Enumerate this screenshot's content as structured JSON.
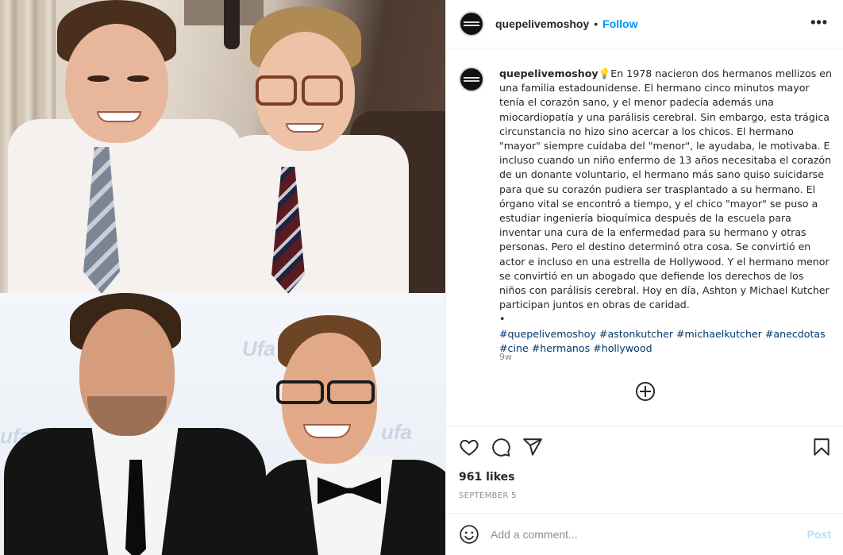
{
  "post": {
    "username": "quepelivemoshoy",
    "follow_label": "Follow",
    "separator": "•",
    "more_options": "•••",
    "caption_intro_emoji": "💡",
    "caption_text": "En 1978 nacieron dos hermanos mellizos en una familia estadounidense. El hermano cinco minutos mayor tenía el corazón sano, y el menor padecía además una miocardiopatía y una parálisis cerebral. Sin embargo, esta trágica circunstancia no hizo sino acercar a los chicos. El hermano \"mayor\" siempre cuidaba del \"menor\", le ayudaba, le motivaba. E incluso cuando un niño enfermo de 13 años necesitaba el corazón de un donante voluntario, el hermano más sano quiso suicidarse para que su corazón pudiera ser trasplantado a su hermano. El órgano vital se encontró a tiempo, y el chico \"mayor\" se puso a estudiar ingeniería bioquímica después de la escuela para inventar una cura de la enfermedad para su hermano y otras personas. Pero el destino determinó otra cosa. Se convirtió en actor e incluso en una estrella de Hollywood. Y el hermano menor se convirtió en un abogado que defiende los derechos de los niños con parálisis cerebral. Hoy en día, Ashton y Michael Kutcher participan juntos en obras de caridad.",
    "caption_bullet": "•",
    "hashtags": "#quepelivemoshoy #astonkutcher #michaelkutcher #anecdotas #cine #hermanos #hollywood",
    "time_ago": "9w",
    "likes": "961 likes",
    "date": "SEPTEMBER 5"
  },
  "actions": {
    "like_icon": "heart-icon",
    "comment_icon": "comment-icon",
    "share_icon": "paper-plane-icon",
    "save_icon": "bookmark-icon"
  },
  "comment_bar": {
    "placeholder": "Add a comment...",
    "post_label": "Post",
    "emoji_icon": "smiley-icon"
  },
  "photo": {
    "backdrop_words": [
      "ufa",
      "Ufa",
      "ufa"
    ]
  }
}
